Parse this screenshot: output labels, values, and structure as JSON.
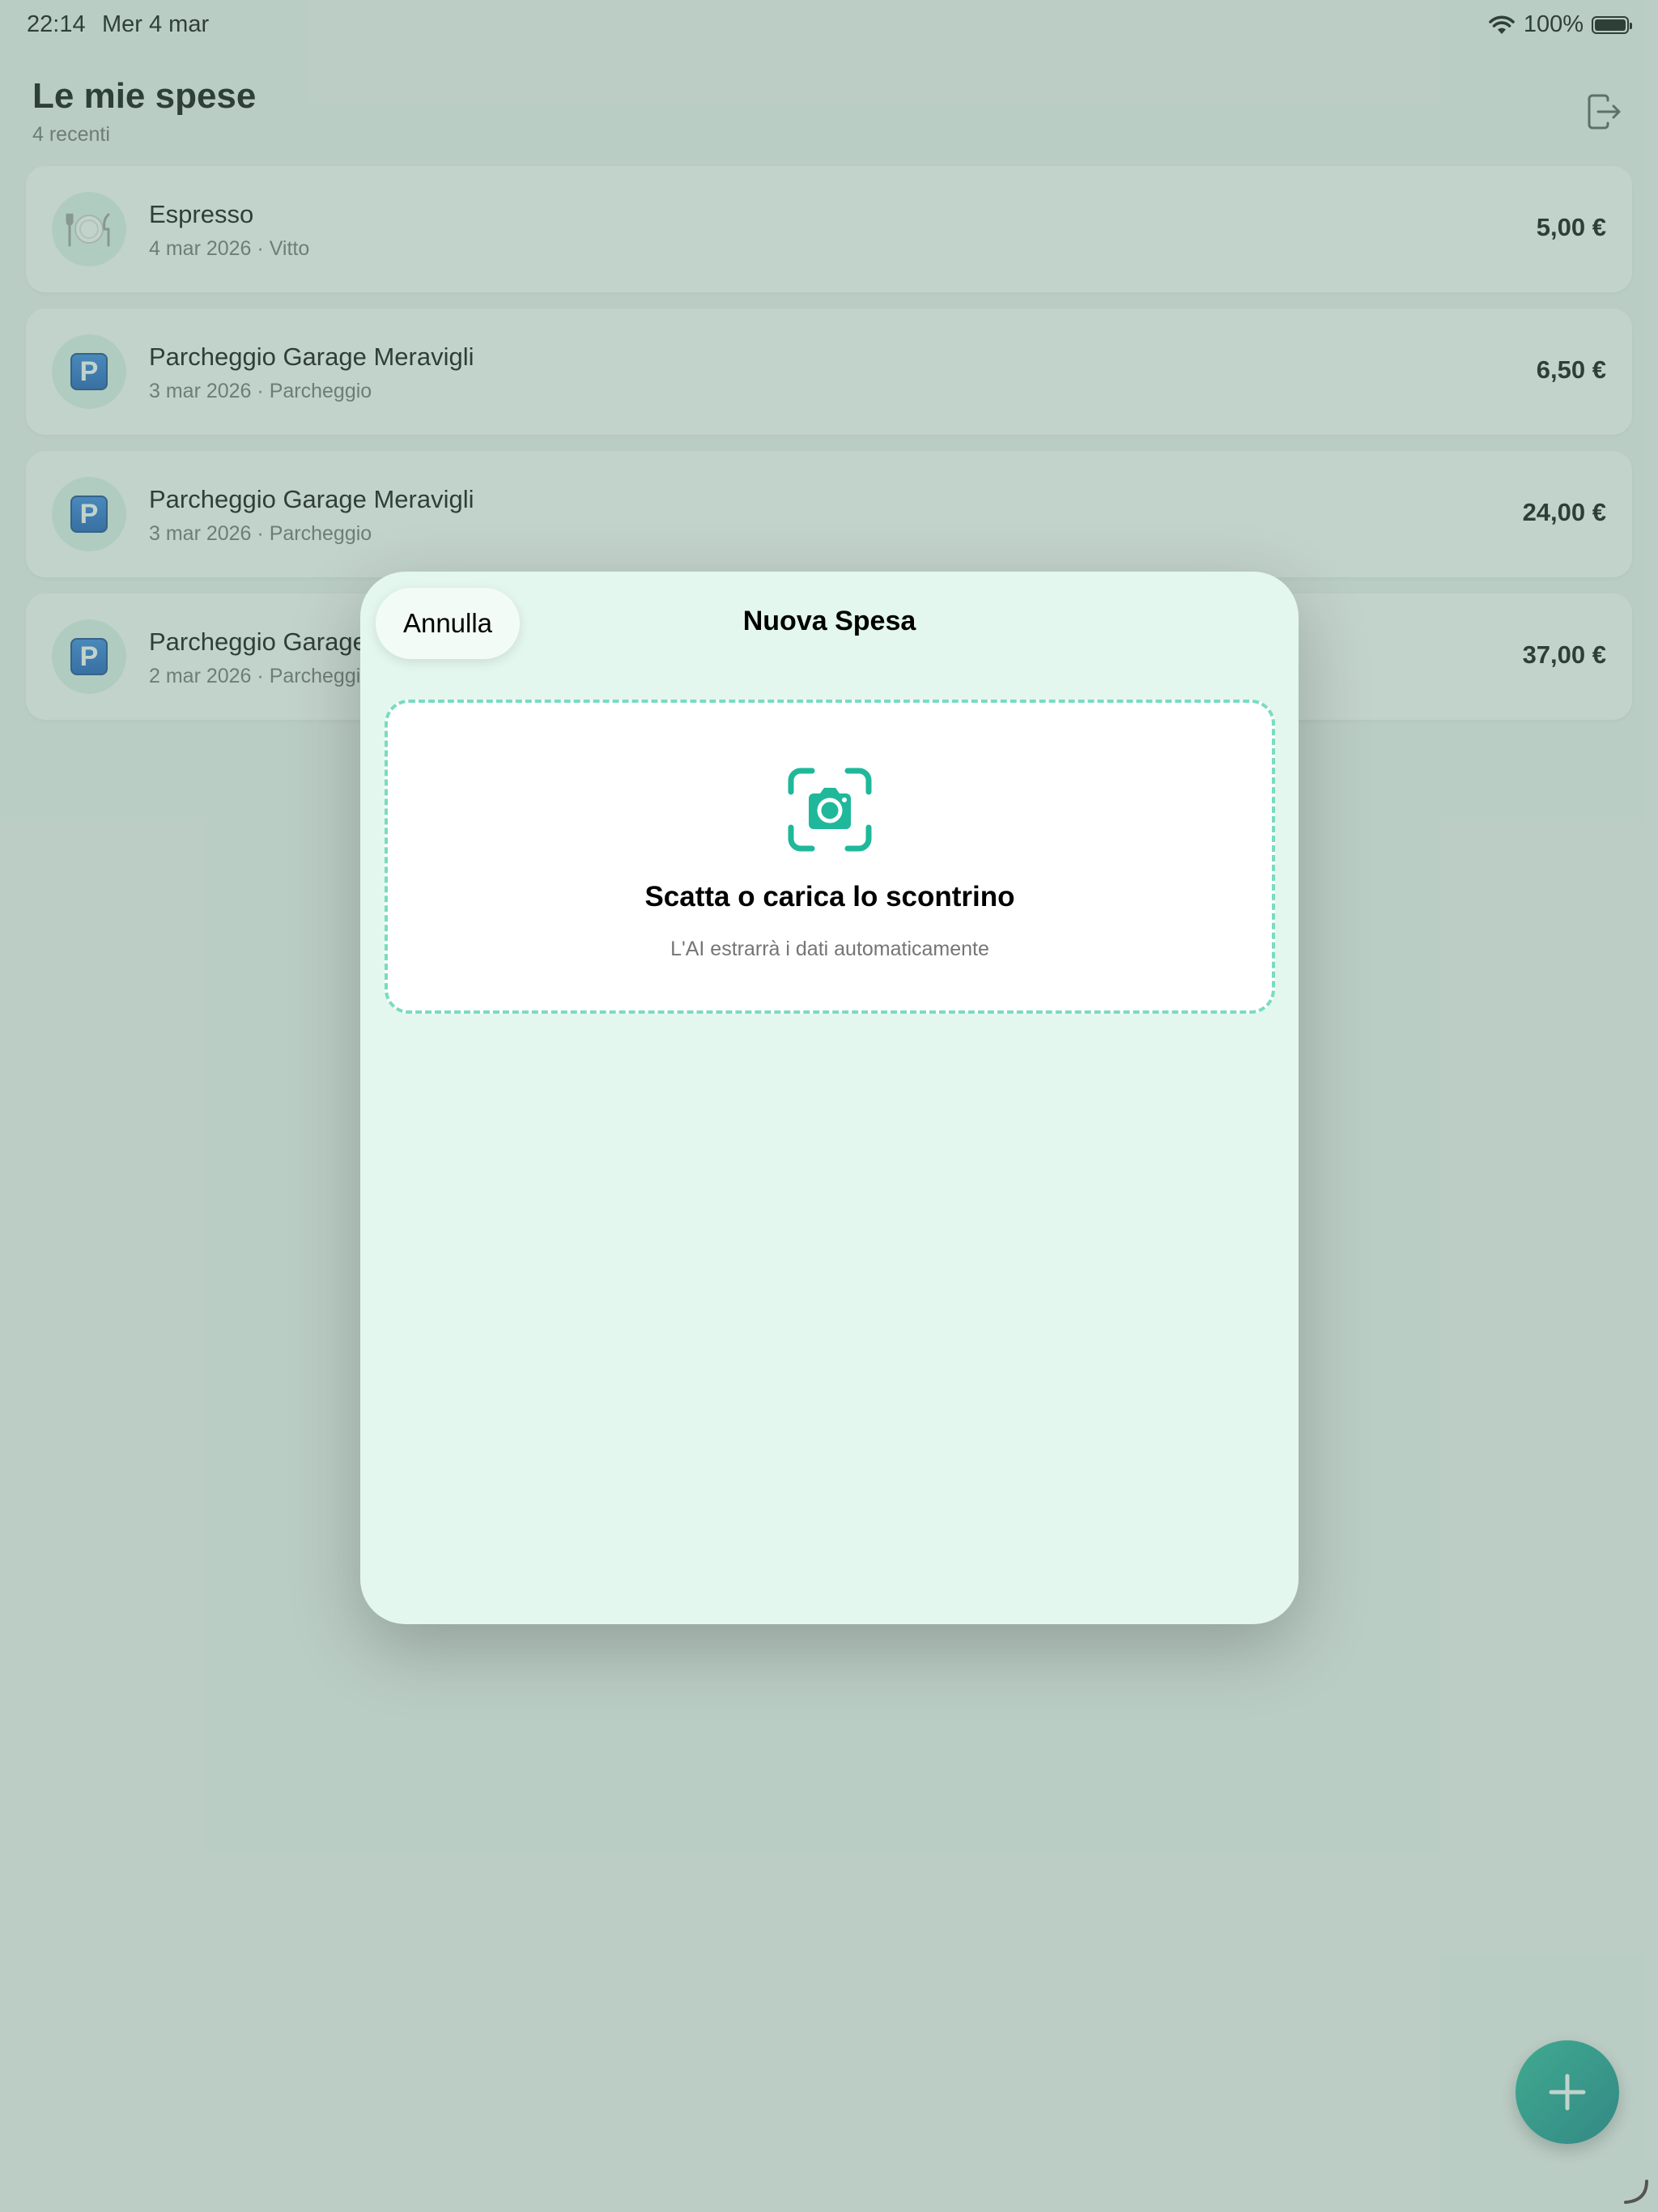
{
  "status_bar": {
    "time": "22:14",
    "date": "Mer 4 mar",
    "battery": "100%"
  },
  "header": {
    "title": "Le mie spese",
    "subtitle": "4 recenti"
  },
  "expenses": [
    {
      "name": "Espresso",
      "date": "4 mar 2026",
      "category": "Vitto",
      "amount": "5,00 €",
      "icon": "fork-knife-plate-icon"
    },
    {
      "name": "Parcheggio Garage Meravigli",
      "date": "3 mar 2026",
      "category": "Parcheggio",
      "amount": "6,50 €",
      "icon": "parking-icon"
    },
    {
      "name": "Parcheggio Garage Meravigli",
      "date": "3 mar 2026",
      "category": "Parcheggio",
      "amount": "24,00 €",
      "icon": "parking-icon"
    },
    {
      "name": "Parcheggio Garage Meravigli",
      "date": "2 mar 2026",
      "category": "Parcheggio",
      "amount": "37,00 €",
      "icon": "parking-icon"
    }
  ],
  "meta_separator": "·",
  "parking_letter": "P",
  "sheet": {
    "cancel_label": "Annulla",
    "title": "Nuova Spesa",
    "upload_title": "Scatta o carica lo scontrino",
    "upload_subtitle": "L'AI estrarrà i dati automaticamente"
  },
  "colors": {
    "accent": "#1fb89a",
    "sheet_background": "#e3f7ee",
    "dashed_border": "#79dcc0"
  }
}
